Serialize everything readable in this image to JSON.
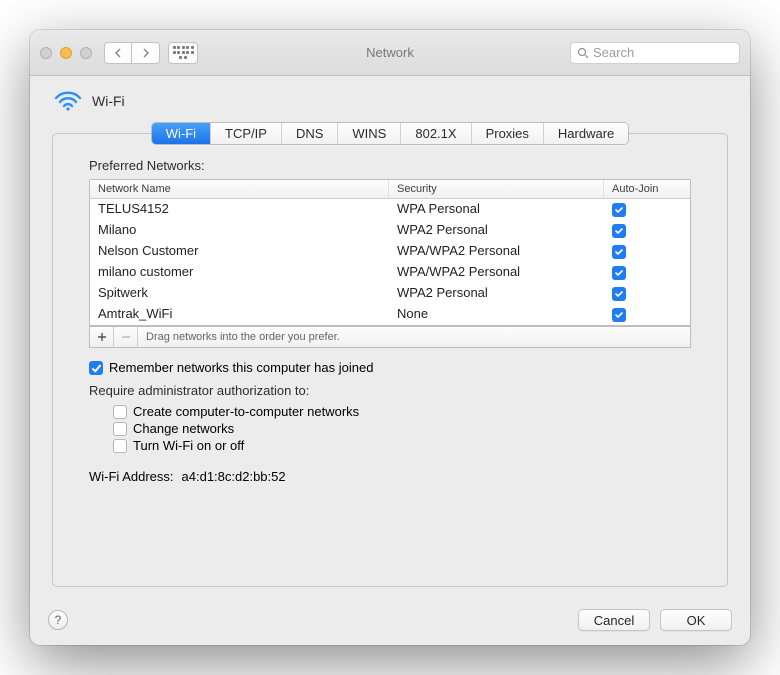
{
  "window": {
    "title": "Network",
    "search_placeholder": "Search"
  },
  "header": {
    "title": "Wi-Fi"
  },
  "tabs": [
    "Wi-Fi",
    "TCP/IP",
    "DNS",
    "WINS",
    "802.1X",
    "Proxies",
    "Hardware"
  ],
  "active_tab": "Wi-Fi",
  "table": {
    "title": "Preferred Networks:",
    "columns": {
      "name": "Network Name",
      "security": "Security",
      "auto": "Auto-Join"
    },
    "rows": [
      {
        "name": "TELUS4152",
        "security": "WPA Personal",
        "auto": true
      },
      {
        "name": "Milano",
        "security": "WPA2 Personal",
        "auto": true
      },
      {
        "name": "Nelson Customer",
        "security": "WPA/WPA2 Personal",
        "auto": true
      },
      {
        "name": "milano customer",
        "security": "WPA/WPA2 Personal",
        "auto": true
      },
      {
        "name": "Spitwerk",
        "security": "WPA2 Personal",
        "auto": true
      },
      {
        "name": "Amtrak_WiFi",
        "security": "None",
        "auto": true
      }
    ],
    "drag_hint": "Drag networks into the order you prefer."
  },
  "options": {
    "remember": {
      "label": "Remember networks this computer has joined",
      "checked": true
    },
    "require_label": "Require administrator authorization to:",
    "create": {
      "label": "Create computer-to-computer networks",
      "checked": false
    },
    "change": {
      "label": "Change networks",
      "checked": false
    },
    "toggle": {
      "label": "Turn Wi-Fi on or off",
      "checked": false
    }
  },
  "address": {
    "label": "Wi-Fi Address:",
    "value": "a4:d1:8c:d2:bb:52"
  },
  "buttons": {
    "help": "?",
    "cancel": "Cancel",
    "ok": "OK"
  }
}
